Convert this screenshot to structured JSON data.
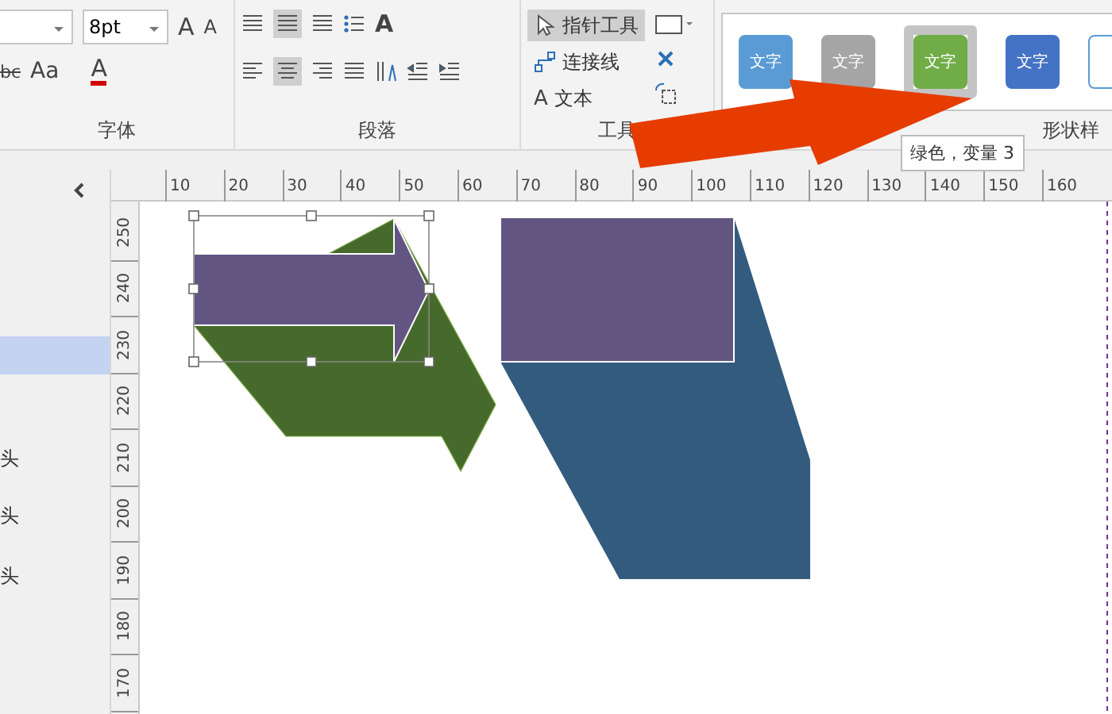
{
  "ribbon": {
    "font_group": {
      "font_size": "8pt",
      "grow": "A",
      "shrink": "A",
      "strike": "bc",
      "change_case": "Aa",
      "font_color": "A",
      "label": "字体"
    },
    "paragraph_group": {
      "text_direction": "A",
      "label": "段落"
    },
    "tools_group": {
      "tools": [
        {
          "kind": "pointer",
          "label": "指针工具",
          "selected": true
        },
        {
          "kind": "connector",
          "label": "连接线",
          "selected": false
        },
        {
          "kind": "text",
          "glyph": "A",
          "label": "文本",
          "selected": false
        }
      ],
      "label": "工具"
    },
    "styles_group": {
      "swatches": [
        {
          "text": "文字",
          "color": "#5b9bd5",
          "selected": false
        },
        {
          "text": "文字",
          "color": "#a5a5a5",
          "selected": false
        },
        {
          "text": "文字",
          "color": "#70ad47",
          "selected": true
        },
        {
          "text": "文字",
          "color": "#4472c4",
          "selected": false
        },
        {
          "color": "#ffffff",
          "selected": false
        }
      ],
      "label": "形状样"
    }
  },
  "tooltip": "绿色，变量 3",
  "h_ruler": [
    "10",
    "20",
    "30",
    "40",
    "50",
    "60",
    "70",
    "80",
    "90",
    "100",
    "110",
    "120",
    "130",
    "140",
    "150",
    "160"
  ],
  "v_ruler": [
    "250",
    "240",
    "230",
    "220",
    "210",
    "200",
    "190",
    "180",
    "170"
  ],
  "panel_items": [
    {
      "selected": true
    },
    {
      "label": "头",
      "selected": false
    },
    {
      "label": "头",
      "selected": false
    },
    {
      "label": "头",
      "selected": false
    }
  ]
}
